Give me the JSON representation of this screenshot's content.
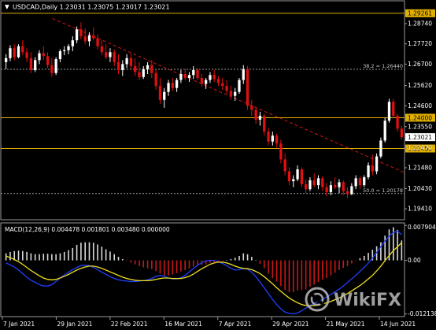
{
  "header": {
    "dropdown_glyph": "▼",
    "symbol_line": "USDCAD,Daily  1.23031 1.23075 1.23017 1.23021"
  },
  "colors": {
    "background": "#000000",
    "frame": "#9a9a9a",
    "up_candle": "#ffffff",
    "down_candle": "#e01010",
    "level_line": "#e0b000",
    "trend_line": "#d01818",
    "fib_line": "#9a9a9a",
    "macd_pos_hist": "#d8d8d8",
    "macd_neg_hist": "#c81818",
    "macd_main": "#2040ff",
    "macd_signal": "#f0e020",
    "current_price_tag": "#ffffff"
  },
  "watermark": {
    "brand": "WikiFX",
    "logo_icon": "wikifx-logo-icon"
  },
  "chart_data": [
    {
      "type": "candlestick",
      "name": "USDCAD,Daily",
      "title": "USDCAD,Daily",
      "ohlc_readout": {
        "open": 1.23031,
        "high": 1.23075,
        "low": 1.23017,
        "close": 1.23021
      },
      "y_range": [
        1.189,
        1.2985
      ],
      "y_ticks": [
        "1.28740",
        "1.27720",
        "1.26700",
        "1.25620",
        "1.24600",
        "1.23550",
        "1.22470",
        "1.21480",
        "1.20430",
        "1.19410"
      ],
      "x_ticks": [
        "7 Jan 2021",
        "29 Jan 2021",
        "22 Feb 2021",
        "16 Mar 2021",
        "7 Apr 2021",
        "29 Apr 2021",
        "21 May 2021",
        "14 Jun 2021"
      ],
      "levels": [
        {
          "price": 1.29261,
          "label": "1.29261",
          "color": "#e0b000"
        },
        {
          "price": 1.24,
          "label": "1.24000",
          "color": "#e0b000"
        },
        {
          "price": 1.2245,
          "label": "1.22450",
          "color": "#e0b000"
        }
      ],
      "fib_levels": [
        {
          "price": 1.2644,
          "label": "38.2 = 1.26440"
        },
        {
          "price": 1.20178,
          "label": "50.0 = 1.20178"
        }
      ],
      "current_price": 1.23021,
      "current_price_label": "1.23021",
      "trendline": {
        "from": {
          "bar": 44,
          "price": 1.29
        },
        "to": {
          "bar": 352,
          "price": 1.2125
        }
      },
      "candles": [
        [
          1.268,
          1.272,
          1.2645,
          1.27
        ],
        [
          1.27,
          1.2765,
          1.2685,
          1.275
        ],
        [
          1.275,
          1.277,
          1.269,
          1.2705
        ],
        [
          1.2705,
          1.277,
          1.27,
          1.276
        ],
        [
          1.276,
          1.279,
          1.2715,
          1.273
        ],
        [
          1.273,
          1.275,
          1.268,
          1.27
        ],
        [
          1.27,
          1.273,
          1.2625,
          1.264
        ],
        [
          1.264,
          1.2705,
          1.263,
          1.269
        ],
        [
          1.269,
          1.274,
          1.267,
          1.2725
        ],
        [
          1.2725,
          1.276,
          1.269,
          1.271
        ],
        [
          1.271,
          1.273,
          1.265,
          1.2665
        ],
        [
          1.2665,
          1.27,
          1.2605,
          1.2625
        ],
        [
          1.2625,
          1.2705,
          1.2615,
          1.2695
        ],
        [
          1.2695,
          1.2745,
          1.268,
          1.2735
        ],
        [
          1.2735,
          1.276,
          1.2715,
          1.274
        ],
        [
          1.274,
          1.277,
          1.272,
          1.276
        ],
        [
          1.276,
          1.281,
          1.2735,
          1.279
        ],
        [
          1.279,
          1.286,
          1.2775,
          1.2845
        ],
        [
          1.2845,
          1.288,
          1.2795,
          1.281
        ],
        [
          1.281,
          1.285,
          1.277,
          1.2785
        ],
        [
          1.2785,
          1.283,
          1.276,
          1.2815
        ],
        [
          1.2815,
          1.2855,
          1.279,
          1.28
        ],
        [
          1.28,
          1.282,
          1.2745,
          1.276
        ],
        [
          1.276,
          1.279,
          1.2715,
          1.273
        ],
        [
          1.273,
          1.277,
          1.2695,
          1.2705
        ],
        [
          1.2705,
          1.275,
          1.268,
          1.273
        ],
        [
          1.273,
          1.2745,
          1.266,
          1.268
        ],
        [
          1.268,
          1.272,
          1.262,
          1.264
        ],
        [
          1.264,
          1.269,
          1.261,
          1.267
        ],
        [
          1.267,
          1.272,
          1.265,
          1.27
        ],
        [
          1.27,
          1.2725,
          1.2645,
          1.266
        ],
        [
          1.266,
          1.27,
          1.261,
          1.263
        ],
        [
          1.263,
          1.268,
          1.259,
          1.2605
        ],
        [
          1.2605,
          1.266,
          1.2595,
          1.2645
        ],
        [
          1.2645,
          1.268,
          1.262,
          1.2665
        ],
        [
          1.2665,
          1.269,
          1.26,
          1.2625
        ],
        [
          1.2625,
          1.264,
          1.254,
          1.256
        ],
        [
          1.256,
          1.26,
          1.247,
          1.249
        ],
        [
          1.249,
          1.255,
          1.245,
          1.253
        ],
        [
          1.253,
          1.259,
          1.251,
          1.2575
        ],
        [
          1.2575,
          1.26,
          1.2535,
          1.255
        ],
        [
          1.255,
          1.26,
          1.253,
          1.259
        ],
        [
          1.259,
          1.264,
          1.2575,
          1.262
        ],
        [
          1.262,
          1.2645,
          1.259,
          1.26
        ],
        [
          1.26,
          1.263,
          1.258,
          1.2615
        ],
        [
          1.2615,
          1.266,
          1.2595,
          1.264
        ],
        [
          1.264,
          1.265,
          1.259,
          1.26
        ],
        [
          1.26,
          1.262,
          1.2555,
          1.257
        ],
        [
          1.257,
          1.26,
          1.2545,
          1.259
        ],
        [
          1.259,
          1.263,
          1.2575,
          1.2615
        ],
        [
          1.2615,
          1.264,
          1.258,
          1.2595
        ],
        [
          1.2595,
          1.261,
          1.256,
          1.2575
        ],
        [
          1.2575,
          1.26,
          1.254,
          1.256
        ],
        [
          1.256,
          1.259,
          1.252,
          1.2535
        ],
        [
          1.2535,
          1.256,
          1.249,
          1.251
        ],
        [
          1.251,
          1.255,
          1.2485,
          1.253
        ],
        [
          1.253,
          1.26,
          1.252,
          1.259
        ],
        [
          1.259,
          1.2665,
          1.257,
          1.2645
        ],
        [
          1.2645,
          1.266,
          1.244,
          1.246
        ],
        [
          1.246,
          1.249,
          1.241,
          1.244
        ],
        [
          1.244,
          1.245,
          1.237,
          1.239
        ],
        [
          1.239,
          1.243,
          1.236,
          1.241
        ],
        [
          1.241,
          1.242,
          1.231,
          1.233
        ],
        [
          1.233,
          1.235,
          1.226,
          1.228
        ],
        [
          1.228,
          1.233,
          1.226,
          1.231
        ],
        [
          1.231,
          1.232,
          1.225,
          1.227
        ],
        [
          1.227,
          1.229,
          1.217,
          1.219
        ],
        [
          1.219,
          1.222,
          1.211,
          1.213
        ],
        [
          1.213,
          1.215,
          1.206,
          1.208
        ],
        [
          1.208,
          1.211,
          1.205,
          1.209
        ],
        [
          1.209,
          1.216,
          1.208,
          1.214
        ],
        [
          1.214,
          1.215,
          1.205,
          1.2065
        ],
        [
          1.2065,
          1.209,
          1.202,
          1.204
        ],
        [
          1.204,
          1.21,
          1.203,
          1.2085
        ],
        [
          1.2085,
          1.212,
          1.205,
          1.206
        ],
        [
          1.206,
          1.211,
          1.204,
          1.2095
        ],
        [
          1.2095,
          1.2105,
          1.203,
          1.205
        ],
        [
          1.205,
          1.207,
          1.2005,
          1.2025
        ],
        [
          1.2025,
          1.208,
          1.201,
          1.206
        ],
        [
          1.206,
          1.21,
          1.204,
          1.205
        ],
        [
          1.205,
          1.209,
          1.202,
          1.2075
        ],
        [
          1.2075,
          1.2085,
          1.201,
          1.203
        ],
        [
          1.203,
          1.205,
          1.1995,
          1.2015
        ],
        [
          1.2015,
          1.207,
          1.201,
          1.2055
        ],
        [
          1.2055,
          1.211,
          1.204,
          1.2095
        ],
        [
          1.2095,
          1.2105,
          1.204,
          1.206
        ],
        [
          1.206,
          1.211,
          1.205,
          1.21
        ],
        [
          1.21,
          1.2175,
          1.209,
          1.216
        ],
        [
          1.216,
          1.2215,
          1.211,
          1.213
        ],
        [
          1.213,
          1.222,
          1.2115,
          1.2205
        ],
        [
          1.2205,
          1.23,
          1.2195,
          1.2285
        ],
        [
          1.2285,
          1.24,
          1.2275,
          1.2385
        ],
        [
          1.2385,
          1.2495,
          1.2375,
          1.248
        ],
        [
          1.248,
          1.2495,
          1.24,
          1.241
        ],
        [
          1.241,
          1.242,
          1.233,
          1.2345
        ],
        [
          1.2345,
          1.236,
          1.229,
          1.2302
        ]
      ]
    },
    {
      "type": "macd",
      "label": "MACD(12,26,9) 0.004478 0.001801 0.003480 0.000000",
      "y_range": [
        -0.01255,
        0.0083
      ],
      "y_ticks": [
        "0.007904",
        "0.00",
        "-0.012138"
      ],
      "histogram": [
        0.0016,
        0.0019,
        0.0021,
        0.0022,
        0.0021,
        0.0019,
        0.0016,
        0.0014,
        0.0014,
        0.0015,
        0.0015,
        0.0014,
        0.0014,
        0.0016,
        0.0019,
        0.0023,
        0.0028,
        0.0035,
        0.004,
        0.0041,
        0.0041,
        0.004,
        0.0036,
        0.0031,
        0.0025,
        0.002,
        0.0014,
        0.0008,
        0.0003,
        -0.0001,
        -0.0005,
        -0.0009,
        -0.0013,
        -0.0016,
        -0.0018,
        -0.002,
        -0.0024,
        -0.003,
        -0.0034,
        -0.0034,
        -0.0032,
        -0.0029,
        -0.0025,
        -0.0022,
        -0.0018,
        -0.0014,
        -0.0012,
        -0.0011,
        -0.0009,
        -0.0006,
        -0.0004,
        -0.0002,
        -0.0001,
        0.0001,
        0.0003,
        0.0006,
        0.001,
        0.0016,
        0.0014,
        0.0008,
        0.0001,
        -0.0008,
        -0.0018,
        -0.003,
        -0.004,
        -0.0048,
        -0.0058,
        -0.0067,
        -0.0072,
        -0.0072,
        -0.0068,
        -0.0067,
        -0.0066,
        -0.006,
        -0.0055,
        -0.0049,
        -0.0044,
        -0.004,
        -0.0034,
        -0.0028,
        -0.0022,
        -0.0017,
        -0.0013,
        -0.0007,
        -0.0001,
        0.0005,
        0.001,
        0.0017,
        0.0024,
        0.0032,
        0.0041,
        0.0056,
        0.007,
        0.0075,
        0.0069,
        0.0045
      ],
      "macd_line": [
        -0.0006,
        -0.001,
        -0.0015,
        -0.0022,
        -0.003,
        -0.0038,
        -0.0045,
        -0.005,
        -0.0055,
        -0.0058,
        -0.0058,
        -0.0055,
        -0.0048,
        -0.004,
        -0.0033,
        -0.0027,
        -0.0021,
        -0.0016,
        -0.0012,
        -0.0011,
        -0.0012,
        -0.0016,
        -0.0021,
        -0.0027,
        -0.0032,
        -0.0037,
        -0.0041,
        -0.0044,
        -0.0046,
        -0.0047,
        -0.0048,
        -0.0048,
        -0.0047,
        -0.0046,
        -0.0044,
        -0.0041,
        -0.0036,
        -0.0034,
        -0.0036,
        -0.004,
        -0.0042,
        -0.0042,
        -0.0039,
        -0.0034,
        -0.0026,
        -0.0018,
        -0.0011,
        -0.0005,
        -0.0001,
        0.0,
        0.0,
        -0.0003,
        -0.0007,
        -0.0012,
        -0.0018,
        -0.0022,
        -0.0021,
        -0.0018,
        -0.002,
        -0.0027,
        -0.0037,
        -0.0049,
        -0.0062,
        -0.0075,
        -0.0088,
        -0.01,
        -0.011,
        -0.0117,
        -0.012,
        -0.0121,
        -0.0119,
        -0.0114,
        -0.0108,
        -0.0102,
        -0.0097,
        -0.0093,
        -0.0088,
        -0.0083,
        -0.0077,
        -0.0071,
        -0.0065,
        -0.0058,
        -0.005,
        -0.0042,
        -0.0034,
        -0.0025,
        -0.0016,
        -0.0006,
        0.0005,
        0.0018,
        0.0031,
        0.0044,
        0.0055,
        0.0063,
        0.0066,
        0.0058
      ],
      "signal_line": [
        0.001,
        0.0006,
        0.0002,
        -0.0003,
        -0.0009,
        -0.0016,
        -0.0023,
        -0.0029,
        -0.0035,
        -0.004,
        -0.0043,
        -0.0044,
        -0.0043,
        -0.004,
        -0.0036,
        -0.0032,
        -0.0027,
        -0.0022,
        -0.0018,
        -0.0015,
        -0.0013,
        -0.0013,
        -0.0015,
        -0.0018,
        -0.0022,
        -0.0026,
        -0.003,
        -0.0034,
        -0.0038,
        -0.0041,
        -0.0043,
        -0.0045,
        -0.0046,
        -0.0046,
        -0.0046,
        -0.0045,
        -0.0043,
        -0.0041,
        -0.004,
        -0.004,
        -0.0041,
        -0.0041,
        -0.0041,
        -0.0039,
        -0.0036,
        -0.0031,
        -0.0025,
        -0.0019,
        -0.0014,
        -0.0009,
        -0.0006,
        -0.0004,
        -0.0004,
        -0.0006,
        -0.0009,
        -0.0013,
        -0.0016,
        -0.0018,
        -0.0019,
        -0.0021,
        -0.0025,
        -0.003,
        -0.0037,
        -0.0045,
        -0.0053,
        -0.0062,
        -0.007,
        -0.0078,
        -0.0085,
        -0.0091,
        -0.0096,
        -0.01,
        -0.0102,
        -0.0103,
        -0.0102,
        -0.0101,
        -0.0099,
        -0.0096,
        -0.0093,
        -0.0089,
        -0.0085,
        -0.008,
        -0.0075,
        -0.0069,
        -0.0063,
        -0.0057,
        -0.005,
        -0.0042,
        -0.0034,
        -0.0024,
        -0.0013,
        -0.0001,
        0.0011,
        0.0022,
        0.0031,
        0.004
      ]
    }
  ]
}
